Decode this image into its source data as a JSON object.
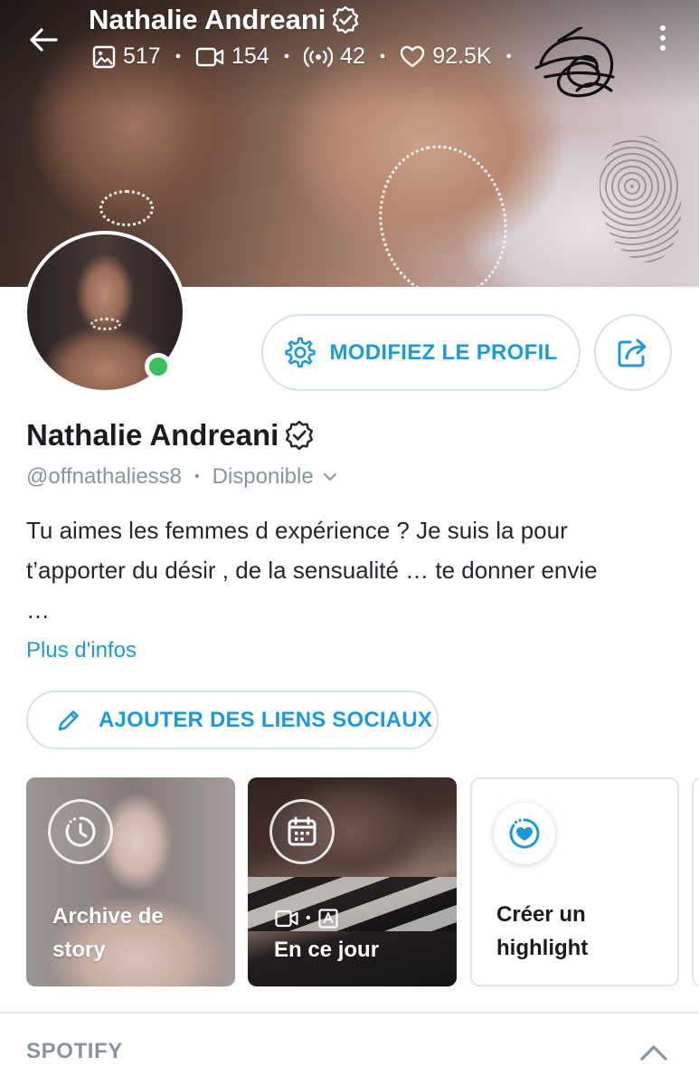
{
  "header": {
    "title": "Nathalie Andreani",
    "stats": [
      {
        "icon": "image-icon",
        "value": "517"
      },
      {
        "icon": "video-icon",
        "value": "154"
      },
      {
        "icon": "live-stream-icon",
        "value": "42"
      },
      {
        "icon": "heart-icon",
        "value": "92.5K"
      }
    ]
  },
  "profile": {
    "name": "Nathalie Andreani",
    "handle": "@offnathaliess8",
    "status": "Disponible",
    "bio_lines": [
      "Tu aimes les femmes d expérience ? Je suis la pour",
      "t’apporter du désir , de la sensualité … te donner envie",
      "…"
    ],
    "more_info": "Plus d'infos"
  },
  "actions": {
    "edit_profile": "MODIFIEZ LE PROFIL",
    "add_social_links": "AJOUTER DES LIENS SOCIAUX"
  },
  "highlights": [
    {
      "label_line1": "Archive de",
      "label_line2": "story",
      "icon": "clock-history-icon"
    },
    {
      "label_line1": "En ce jour",
      "icon": "calendar-icon"
    },
    {
      "label_line1": "Créer un",
      "label_line2": "highlight",
      "icon": "heart-plus-icon"
    }
  ],
  "sections": {
    "spotify": "SPOTIFY"
  },
  "colors": {
    "accent": "#1e9ad6",
    "online": "#3cbf5d",
    "muted": "#8a949e",
    "border": "#d9e1e8"
  }
}
